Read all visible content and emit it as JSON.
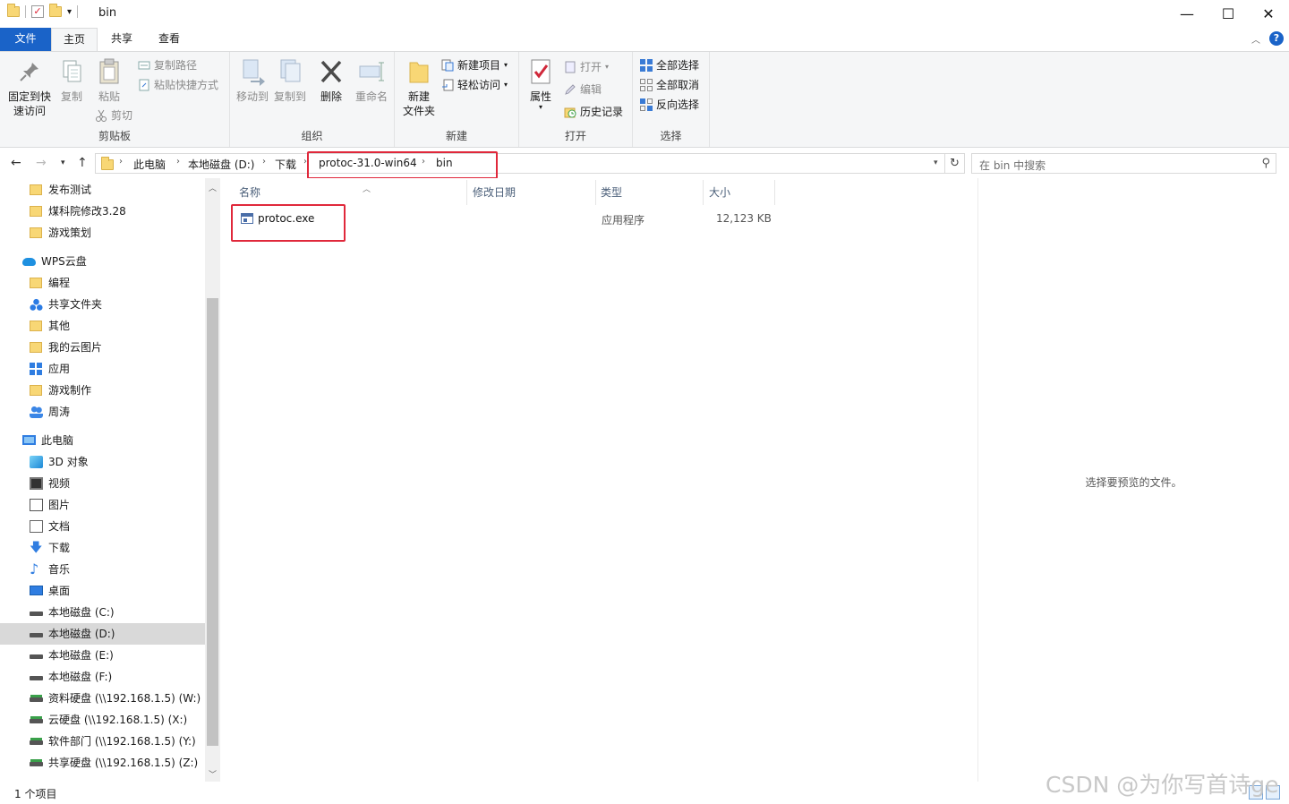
{
  "window": {
    "title": "bin",
    "minimize_glyph": "—",
    "maximize_glyph": "☐",
    "close_glyph": "✕"
  },
  "quick_access": {
    "pin_glyph": "▾"
  },
  "tabs": {
    "file": "文件",
    "home": "主页",
    "share": "共享",
    "view": "查看"
  },
  "help_glyph": "?",
  "ribbon": {
    "clipboard": {
      "label": "剪贴板",
      "pin_line1": "固定到快",
      "pin_line2": "速访问",
      "copy": "复制",
      "paste": "粘贴",
      "copy_path": "复制路径",
      "paste_shortcut": "粘贴快捷方式",
      "cut": "剪切"
    },
    "organize": {
      "label": "组织",
      "move_to": "移动到",
      "copy_to": "复制到",
      "delete": "删除",
      "rename": "重命名"
    },
    "new": {
      "label": "新建",
      "new_folder_line1": "新建",
      "new_folder_line2": "文件夹",
      "new_item": "新建项目",
      "easy_access": "轻松访问"
    },
    "open": {
      "label": "打开",
      "properties": "属性",
      "open": "打开",
      "edit": "编辑",
      "history": "历史记录"
    },
    "select": {
      "label": "选择",
      "select_all": "全部选择",
      "select_none": "全部取消",
      "invert": "反向选择"
    }
  },
  "address": {
    "crumbs": [
      "此电脑",
      "本地磁盘 (D:)",
      "下载",
      "protoc-31.0-win64",
      "bin"
    ],
    "search_placeholder": "在 bin 中搜索"
  },
  "nav": {
    "items": [
      {
        "label": "发布测试",
        "icon": "folder-icon"
      },
      {
        "label": "煤科院修改3.28",
        "icon": "folder-icon"
      },
      {
        "label": "游戏策划",
        "icon": "folder-icon"
      },
      {
        "label": "WPS云盘",
        "icon": "cloud-icon"
      },
      {
        "label": "编程",
        "icon": "folder-icon"
      },
      {
        "label": "共享文件夹",
        "icon": "shared-folder-icon"
      },
      {
        "label": "其他",
        "icon": "folder-icon"
      },
      {
        "label": "我的云图片",
        "icon": "folder-icon"
      },
      {
        "label": "应用",
        "icon": "apps-icon"
      },
      {
        "label": "游戏制作",
        "icon": "folder-icon"
      },
      {
        "label": "周涛",
        "icon": "user-icon"
      },
      {
        "label": "此电脑",
        "icon": "computer-icon"
      },
      {
        "label": "3D 对象",
        "icon": "3d-objects-icon"
      },
      {
        "label": "视频",
        "icon": "video-icon"
      },
      {
        "label": "图片",
        "icon": "pictures-icon"
      },
      {
        "label": "文档",
        "icon": "documents-icon"
      },
      {
        "label": "下载",
        "icon": "download-icon"
      },
      {
        "label": "音乐",
        "icon": "music-icon"
      },
      {
        "label": "桌面",
        "icon": "desktop-icon"
      },
      {
        "label": "本地磁盘 (C:)",
        "icon": "drive-icon"
      },
      {
        "label": "本地磁盘 (D:)",
        "icon": "drive-icon"
      },
      {
        "label": "本地磁盘 (E:)",
        "icon": "drive-icon"
      },
      {
        "label": "本地磁盘 (F:)",
        "icon": "drive-icon"
      },
      {
        "label": "资料硬盘 (\\\\192.168.1.5) (W:)",
        "icon": "network-drive-icon"
      },
      {
        "label": "云硬盘 (\\\\192.168.1.5) (X:)",
        "icon": "network-drive-icon"
      },
      {
        "label": "软件部门 (\\\\192.168.1.5) (Y:)",
        "icon": "network-drive-icon"
      },
      {
        "label": "共享硬盘 (\\\\192.168.1.5) (Z:)",
        "icon": "network-drive-icon"
      }
    ]
  },
  "files": {
    "columns": {
      "name": "名称",
      "modified": "修改日期",
      "type": "类型",
      "size": "大小"
    },
    "rows": [
      {
        "name": "protoc.exe",
        "modified": "",
        "type": "应用程序",
        "size": "12,123 KB"
      }
    ]
  },
  "preview": {
    "message": "选择要预览的文件。"
  },
  "status": {
    "count": "1 个项目"
  },
  "watermark": "CSDN @为你写首诗ge",
  "colors": {
    "accent": "#1a63c8",
    "highlight_box": "#e0283b",
    "selected_nav": "#d9d9d9"
  }
}
